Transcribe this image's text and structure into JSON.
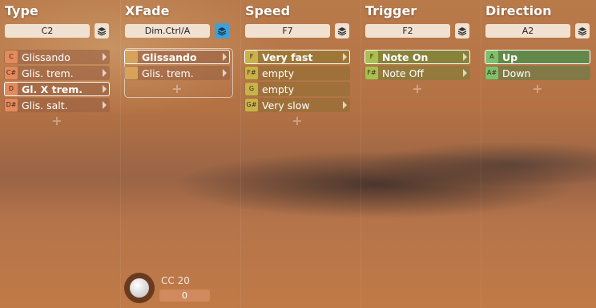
{
  "columns": [
    {
      "title": "Type",
      "selector": "C2",
      "items": [
        {
          "note": "C",
          "label": "Glissando"
        },
        {
          "note": "C#",
          "label": "Glis. trem."
        },
        {
          "note": "D",
          "label": "Gl. X trem."
        },
        {
          "note": "D#",
          "label": "Glis. salt."
        }
      ],
      "selected_index": 2,
      "add_label": "+"
    },
    {
      "title": "XFade",
      "selector": "Dim.Ctrl/A",
      "items": [
        {
          "note": "",
          "label": "Glissando"
        },
        {
          "note": "",
          "label": "Glis. trem."
        }
      ],
      "selected_index": 0,
      "add_label": "+"
    },
    {
      "title": "Speed",
      "selector": "F7",
      "items": [
        {
          "note": "F",
          "label": "Very fast"
        },
        {
          "note": "F#",
          "label": "empty"
        },
        {
          "note": "G",
          "label": "empty"
        },
        {
          "note": "G#",
          "label": "Very slow"
        }
      ],
      "selected_index": 0,
      "add_label": "+"
    },
    {
      "title": "Trigger",
      "selector": "F2",
      "items": [
        {
          "note": "F",
          "label": "Note On"
        },
        {
          "note": "F#",
          "label": "Note Off"
        }
      ],
      "selected_index": 0,
      "add_label": "+"
    },
    {
      "title": "Direction",
      "selector": "A2",
      "items": [
        {
          "note": "A",
          "label": "Up"
        },
        {
          "note": "A#",
          "label": "Down"
        }
      ],
      "selected_index": 0,
      "add_label": "+"
    }
  ],
  "cc_control": {
    "label": "CC 20",
    "value": "0"
  },
  "icons": {
    "layer": "layers-icon",
    "submenu": "chevron-right-icon",
    "knob": "knob-icon"
  },
  "colors": {
    "accent": "#3fa0d8"
  }
}
